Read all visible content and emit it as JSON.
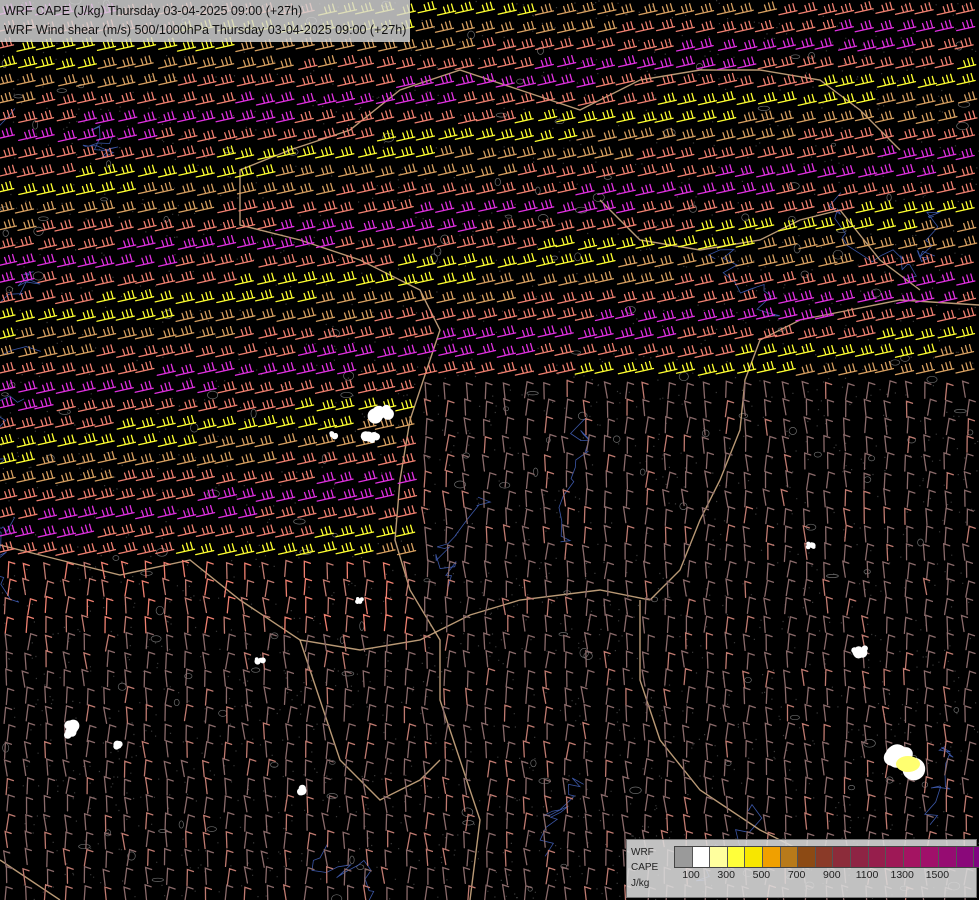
{
  "title": {
    "line1": "WRF CAPE (J/kg) Thursday 03-04-2025 09:00 (+27h)",
    "line2": "WRF Wind shear (m/s) 500/1000hPa Thursday 03-04-2025 09:00 (+27h)"
  },
  "legend": {
    "label_line1": "WRF",
    "label_line2": "CAPE",
    "label_line3": "J/kg",
    "colors": [
      "#9a9a9a",
      "#ffffff",
      "#ffff9e",
      "#ffff3a",
      "#f7e600",
      "#f0a000",
      "#b87a1a",
      "#8c4a14",
      "#8a3a28",
      "#8c2c3a",
      "#8e2444",
      "#961e4c",
      "#9e1856",
      "#a41462",
      "#a0106a",
      "#960c72",
      "#8a087a",
      "#7e0480"
    ],
    "ticks": [
      "100",
      "300",
      "500",
      "700",
      "900",
      "1100",
      "1300",
      "1500"
    ]
  },
  "map": {
    "background_color": "#000000",
    "contour_color": "#9a9a9a",
    "river_color": "#4a6bd0",
    "border_color": "#d9b48a",
    "shear_colors": {
      "low": "#8a6a6a",
      "medium": "#c07a70",
      "pink": "#f08070",
      "tan": "#d8a060",
      "yellow": "#ffff30",
      "magenta": "#e030e0"
    }
  }
}
